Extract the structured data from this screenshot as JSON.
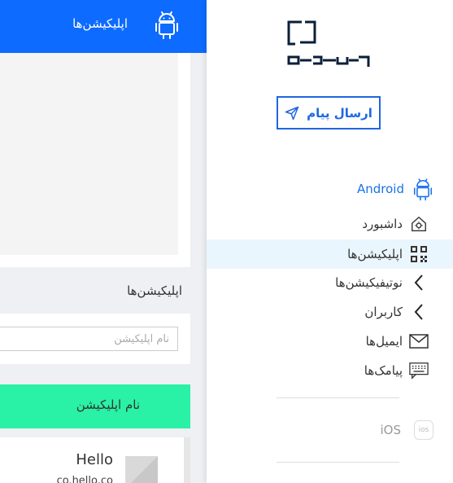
{
  "header": {
    "title": "اپلیکیشن‌ها"
  },
  "main": {
    "section_title": "اپلیکیشن‌ها",
    "search": {
      "placeholder": "نام اپلیکیشن"
    },
    "list_header": "نام اپلیکیشن",
    "apps": [
      {
        "name": "Hello",
        "package": "co.hello.co"
      }
    ]
  },
  "sidebar": {
    "send_button": "ارسال پیام",
    "platforms": {
      "android": "Android",
      "ios": "iOS"
    },
    "items": [
      {
        "label": "داشبورد",
        "icon": "dashboard-gear-icon"
      },
      {
        "label": "اپلیکیشن‌ها",
        "icon": "qr-apps-icon",
        "active": true
      },
      {
        "label": "نوتیفیکیشن‌ها",
        "icon": "chevron-left-icon"
      },
      {
        "label": "کاربران",
        "icon": "chevron-left-icon"
      },
      {
        "label": "ایمیل‌ها",
        "icon": "envelope-icon"
      },
      {
        "label": "پیامک‌ها",
        "icon": "sms-keyboard-icon"
      }
    ],
    "ios_badge": "ios"
  },
  "colors": {
    "brand_blue": "#0d6bff",
    "accent_green": "#29f1a6",
    "active_row": "#eaf6fd"
  }
}
